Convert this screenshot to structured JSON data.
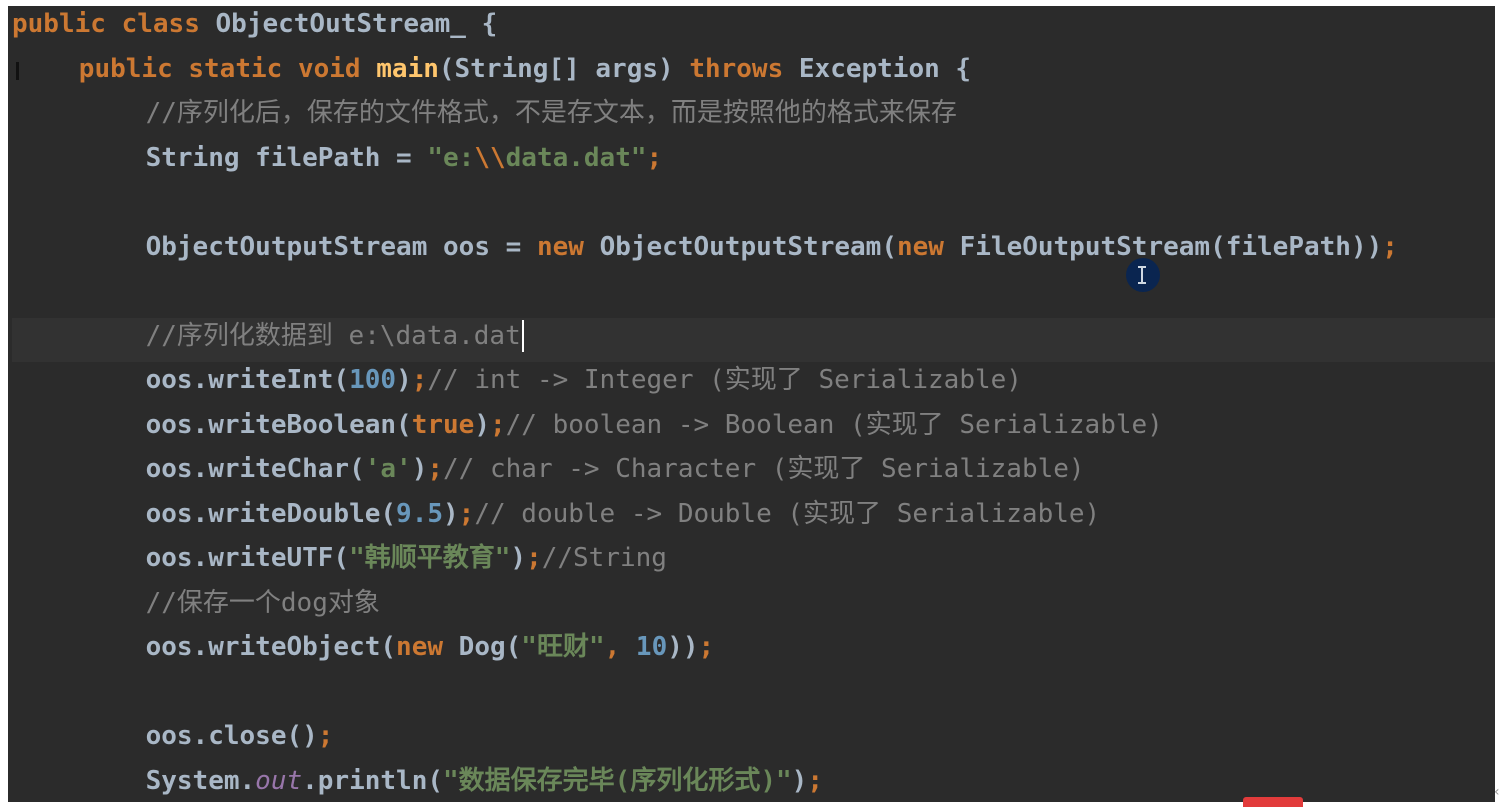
{
  "editor": {
    "lines": [
      {
        "indent": 0,
        "tokens": [
          {
            "t": "public ",
            "k": "kw"
          },
          {
            "t": "class ",
            "k": "kw"
          },
          {
            "t": "ObjectOutStream_ ",
            "k": "id"
          },
          {
            "t": "{",
            "k": "punct"
          }
        ]
      },
      {
        "indent": 4,
        "tokens": [
          {
            "t": "public ",
            "k": "kw"
          },
          {
            "t": "static ",
            "k": "kw"
          },
          {
            "t": "void ",
            "k": "kw"
          },
          {
            "t": "main",
            "k": "fn"
          },
          {
            "t": "(String[] args) ",
            "k": "id"
          },
          {
            "t": "throws ",
            "k": "kw"
          },
          {
            "t": "Exception {",
            "k": "id"
          }
        ]
      },
      {
        "indent": 8,
        "tokens": [
          {
            "t": "//序列化后，保存的文件格式，不是存文本，而是按照他的格式来保存",
            "k": "cm"
          }
        ]
      },
      {
        "indent": 8,
        "tokens": [
          {
            "t": "String filePath = ",
            "k": "id"
          },
          {
            "t": "\"e:",
            "k": "str"
          },
          {
            "t": "\\\\",
            "k": "kw"
          },
          {
            "t": "data.dat\"",
            "k": "str"
          },
          {
            "t": ";",
            "k": "kw"
          }
        ]
      },
      {
        "indent": 0,
        "tokens": []
      },
      {
        "indent": 8,
        "tokens": [
          {
            "t": "ObjectOutputStream oos = ",
            "k": "id"
          },
          {
            "t": "new ",
            "k": "kw"
          },
          {
            "t": "ObjectOutputStream(",
            "k": "id"
          },
          {
            "t": "new ",
            "k": "kw"
          },
          {
            "t": "FileOutputStream(filePath))",
            "k": "id"
          },
          {
            "t": ";",
            "k": "kw"
          }
        ]
      },
      {
        "indent": 0,
        "tokens": []
      },
      {
        "indent": 8,
        "current": true,
        "caret": true,
        "tokens": [
          {
            "t": "//序列化数据到 e:\\data.dat",
            "k": "cm"
          }
        ]
      },
      {
        "indent": 8,
        "tokens": [
          {
            "t": "oos.writeInt(",
            "k": "id"
          },
          {
            "t": "100",
            "k": "num"
          },
          {
            "t": ")",
            "k": "id"
          },
          {
            "t": ";",
            "k": "kw"
          },
          {
            "t": "// int -> Integer (实现了 Serializable)",
            "k": "cm"
          }
        ]
      },
      {
        "indent": 8,
        "tokens": [
          {
            "t": "oos.writeBoolean(",
            "k": "id"
          },
          {
            "t": "true",
            "k": "kw"
          },
          {
            "t": ")",
            "k": "id"
          },
          {
            "t": ";",
            "k": "kw"
          },
          {
            "t": "// boolean -> Boolean (实现了 Serializable)",
            "k": "cm"
          }
        ]
      },
      {
        "indent": 8,
        "tokens": [
          {
            "t": "oos.writeChar(",
            "k": "id"
          },
          {
            "t": "'a'",
            "k": "str"
          },
          {
            "t": ")",
            "k": "id"
          },
          {
            "t": ";",
            "k": "kw"
          },
          {
            "t": "// char -> Character (实现了 Serializable)",
            "k": "cm"
          }
        ]
      },
      {
        "indent": 8,
        "tokens": [
          {
            "t": "oos.writeDouble(",
            "k": "id"
          },
          {
            "t": "9.5",
            "k": "num"
          },
          {
            "t": ")",
            "k": "id"
          },
          {
            "t": ";",
            "k": "kw"
          },
          {
            "t": "// double -> Double (实现了 Serializable)",
            "k": "cm"
          }
        ]
      },
      {
        "indent": 8,
        "tokens": [
          {
            "t": "oos.writeUTF(",
            "k": "id"
          },
          {
            "t": "\"韩顺平教育\"",
            "k": "str"
          },
          {
            "t": ")",
            "k": "id"
          },
          {
            "t": ";",
            "k": "kw"
          },
          {
            "t": "//String",
            "k": "cm"
          }
        ]
      },
      {
        "indent": 8,
        "tokens": [
          {
            "t": "//保存一个dog对象",
            "k": "cm"
          }
        ]
      },
      {
        "indent": 8,
        "tokens": [
          {
            "t": "oos.writeObject(",
            "k": "id"
          },
          {
            "t": "new ",
            "k": "kw"
          },
          {
            "t": "Dog(",
            "k": "id"
          },
          {
            "t": "\"旺财\"",
            "k": "str"
          },
          {
            "t": ", ",
            "k": "kw"
          },
          {
            "t": "10",
            "k": "num"
          },
          {
            "t": "))",
            "k": "id"
          },
          {
            "t": ";",
            "k": "kw"
          }
        ]
      },
      {
        "indent": 0,
        "tokens": []
      },
      {
        "indent": 8,
        "tokens": [
          {
            "t": "oos.close()",
            "k": "id"
          },
          {
            "t": ";",
            "k": "kw"
          }
        ]
      },
      {
        "indent": 8,
        "tokens": [
          {
            "t": "System.",
            "k": "id"
          },
          {
            "t": "out",
            "k": "static"
          },
          {
            "t": ".println(",
            "k": "id"
          },
          {
            "t": "\"数据保存完毕(序列化形式)\"",
            "k": "str"
          },
          {
            "t": ")",
            "k": "id"
          },
          {
            "t": ";",
            "k": "kw"
          }
        ]
      }
    ]
  },
  "colors": {
    "background": "#2b2b2b",
    "keyword": "#cc7832",
    "function": "#ffc66d",
    "string": "#6a8759",
    "number": "#6897bb",
    "comment": "#808080",
    "identifier": "#a9b7c6",
    "static_field": "#9876aa"
  },
  "icons": {
    "mouse_cursor": "text-cursor-icon",
    "right_edge": "chevron-left-icon"
  },
  "right_edge_glyph": "‹"
}
